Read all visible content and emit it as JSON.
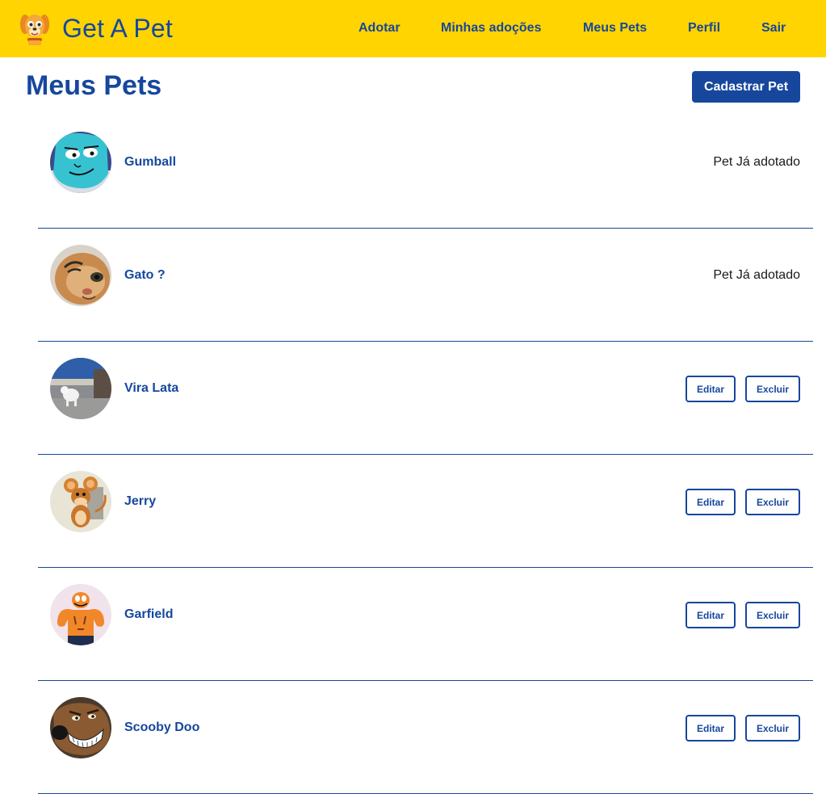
{
  "header": {
    "brand": "Get A Pet",
    "logo_icon": "dog-face-icon",
    "nav": [
      {
        "label": "Adotar"
      },
      {
        "label": "Minhas adoções"
      },
      {
        "label": "Meus Pets"
      },
      {
        "label": "Perfil"
      },
      {
        "label": "Sair"
      }
    ]
  },
  "main": {
    "title": "Meus Pets",
    "add_button_label": "Cadastrar Pet",
    "pets": [
      {
        "name": "Gumball",
        "status": "Pet Já adotado",
        "adopted": true,
        "avatar": "gumball-cartoon-cat"
      },
      {
        "name": "Gato ?",
        "status": "Pet Já adotado",
        "adopted": true,
        "avatar": "orange-cat-photo"
      },
      {
        "name": "Vira Lata",
        "adopted": false,
        "edit_label": "Editar",
        "delete_label": "Excluir",
        "avatar": "white-dog-photo"
      },
      {
        "name": "Jerry",
        "adopted": false,
        "edit_label": "Editar",
        "delete_label": "Excluir",
        "avatar": "jerry-cartoon-mouse"
      },
      {
        "name": "Garfield",
        "adopted": false,
        "edit_label": "Editar",
        "delete_label": "Excluir",
        "avatar": "garfield-cartoon-cat"
      },
      {
        "name": "Scooby Doo",
        "adopted": false,
        "edit_label": "Editar",
        "delete_label": "Excluir",
        "avatar": "scooby-doo-cartoon-dog"
      }
    ]
  },
  "colors": {
    "navbar_bg": "#ffd400",
    "primary": "#16479d",
    "text_dark": "#1a1a1a"
  }
}
